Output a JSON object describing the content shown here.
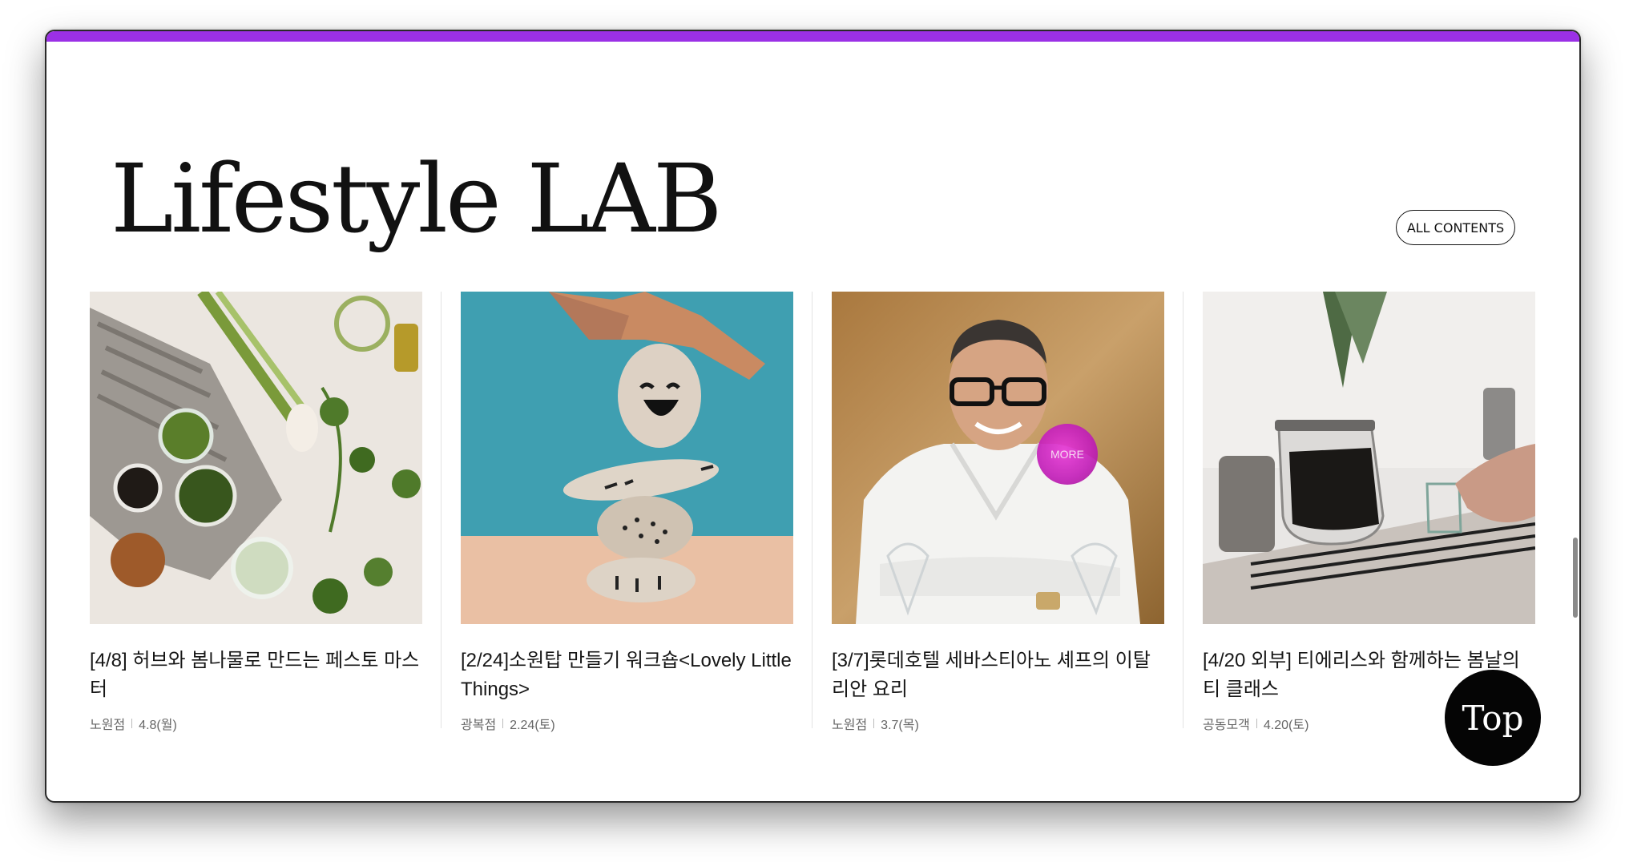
{
  "section": {
    "title": "Lifestyle LAB",
    "all_contents_label": "ALL CONTENTS"
  },
  "cards": [
    {
      "title": "[4/8] 허브와 봄나물로 만드는 페스토 마스터",
      "branch": "노원점",
      "date": "4.8(월)",
      "image": "herbs-pesto-photo"
    },
    {
      "title": "[2/24]소원탑 만들기 워크숍<Lovely Little Things>",
      "branch": "광복점",
      "date": "2.24(토)",
      "image": "stacked-stones-photo"
    },
    {
      "title": "[3/7]롯데호텔 세바스티아노 셰프의 이탈리안 요리",
      "branch": "노원점",
      "date": "3.7(목)",
      "image": "chef-portrait-photo"
    },
    {
      "title": "[4/20 외부] 티에리스와 함께하는 봄날의 티 클래스",
      "branch": "공동모객",
      "date": "4.20(토)",
      "image": "tea-pot-photo"
    }
  ],
  "hover_label": "MORE",
  "top_button_label": "Top",
  "colors": {
    "accent_bar": "#9b30e6",
    "more_cursor": "#d42ac8"
  }
}
